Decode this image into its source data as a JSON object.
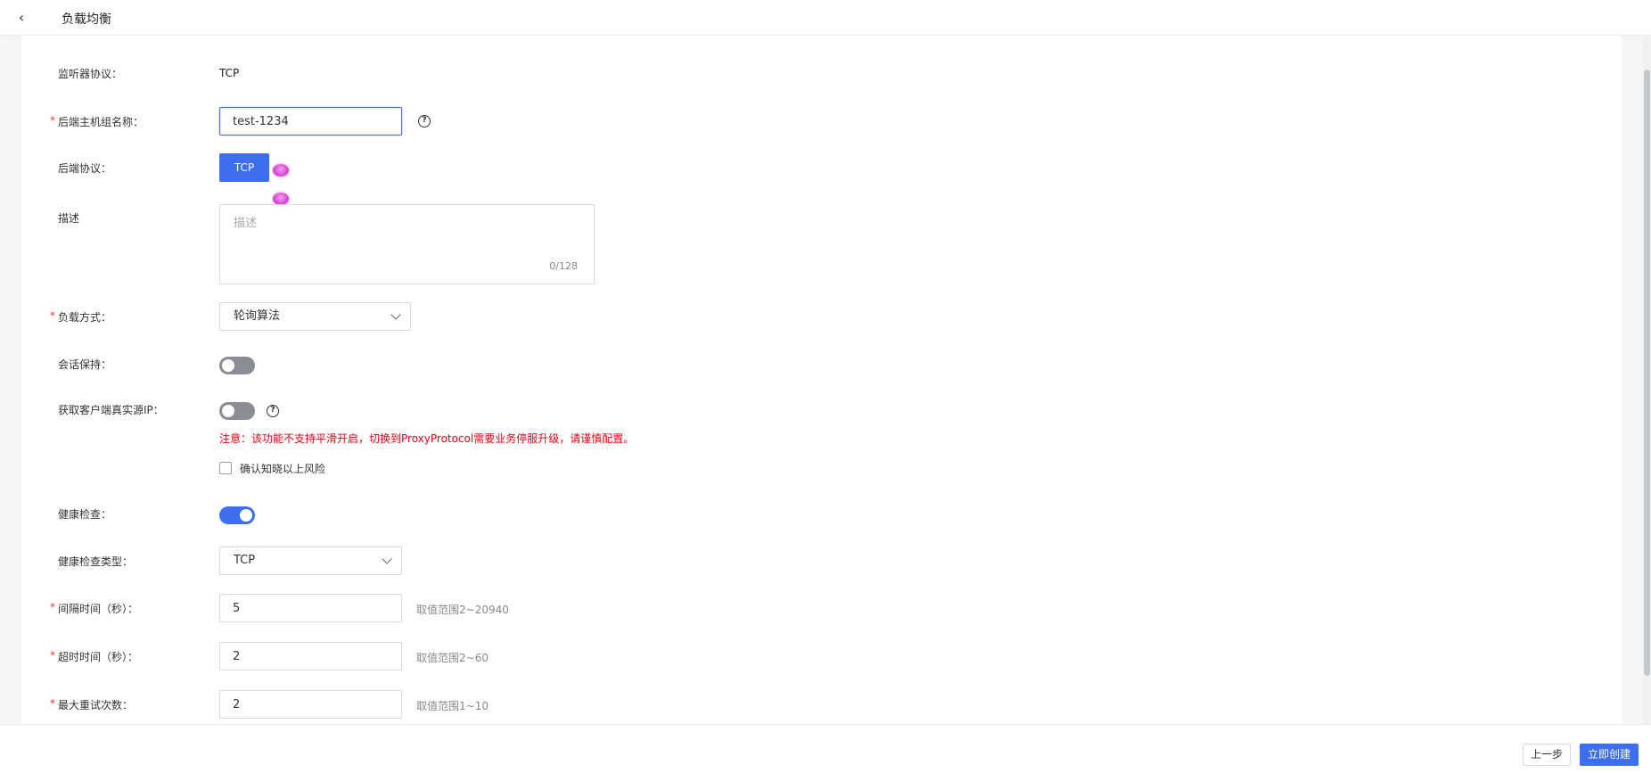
{
  "header": {
    "back_icon": "chevron-left-icon",
    "title": "负载均衡"
  },
  "form": {
    "listener_protocol": {
      "label": "监听器协议：",
      "value": "TCP"
    },
    "backend_group_name": {
      "label": "后端主机组名称：",
      "value": "test-1234"
    },
    "backend_protocol": {
      "label": "后端协议：",
      "value": "TCP"
    },
    "description": {
      "label": "描述",
      "placeholder": "描述",
      "counter": "0/128"
    },
    "lb_method": {
      "label": "负载方式：",
      "value": "轮询算法"
    },
    "session_persistence": {
      "label": "会话保持：",
      "on": false
    },
    "client_real_ip": {
      "label": "获取客户端真实源IP：",
      "on": false,
      "warning": "注意：该功能不支持平滑开启，切换到ProxyProtocol需要业务停服升级，请谨慎配置。",
      "confirm_label": "确认知晓以上风险",
      "confirm_checked": false
    },
    "health_check": {
      "label": "健康检查：",
      "on": true
    },
    "health_check_type": {
      "label": "健康检查类型：",
      "value": "TCP"
    },
    "interval": {
      "label": "间隔时间（秒）：",
      "value": "5",
      "hint": "取值范围2~20940"
    },
    "timeout": {
      "label": "超时时间（秒）：",
      "value": "2",
      "hint": "取值范围2~60"
    },
    "max_retries": {
      "label": "最大重试次数：",
      "value": "2",
      "hint": "取值范围1~10"
    }
  },
  "footer": {
    "prev_label": "上一步",
    "create_label": "立即创建"
  },
  "colors": {
    "primary": "#3d6ef0",
    "warning": "#e60012",
    "required": "#e4393c"
  }
}
